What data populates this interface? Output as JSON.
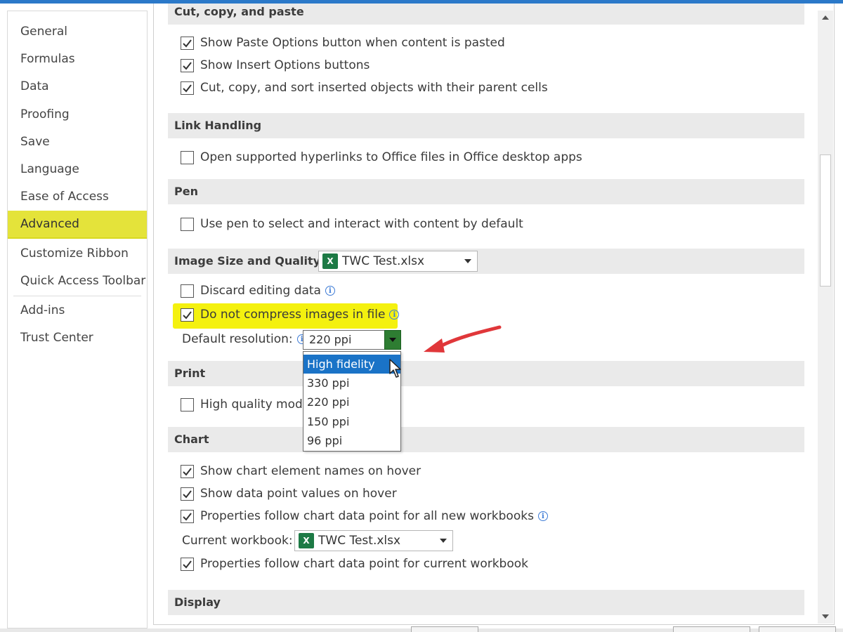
{
  "sidebar": {
    "items": [
      {
        "label": "General"
      },
      {
        "label": "Formulas"
      },
      {
        "label": "Data"
      },
      {
        "label": "Proofing"
      },
      {
        "label": "Save"
      },
      {
        "label": "Language"
      },
      {
        "label": "Ease of Access"
      },
      {
        "label": "Advanced",
        "active": true
      },
      {
        "label": "Customize Ribbon"
      },
      {
        "label": "Quick Access Toolbar"
      },
      {
        "label": "Add-ins"
      },
      {
        "label": "Trust Center"
      }
    ]
  },
  "sections": {
    "cut_copy_paste": {
      "title": "Cut, copy, and paste",
      "options": [
        {
          "label": "Show Paste Options button when content is pasted",
          "checked": true
        },
        {
          "label": "Show Insert Options buttons",
          "checked": true
        },
        {
          "label": "Cut, copy, and sort inserted objects with their parent cells",
          "checked": true
        }
      ]
    },
    "link_handling": {
      "title": "Link Handling",
      "options": [
        {
          "label": "Open supported hyperlinks to Office files in Office desktop apps",
          "checked": false
        }
      ]
    },
    "pen": {
      "title": "Pen",
      "options": [
        {
          "label": "Use pen to select and interact with content by default",
          "checked": false
        }
      ]
    },
    "image": {
      "title": "Image Size and Quality",
      "file_select": "TWC Test.xlsx",
      "discard_label": "Discard editing data",
      "discard_checked": false,
      "compress_label": "Do not compress images in file",
      "compress_checked": true,
      "resolution_label": "Default resolution:",
      "resolution_value": "220 ppi",
      "resolution_options": [
        "High fidelity",
        "330 ppi",
        "220 ppi",
        "150 ppi",
        "96 ppi"
      ],
      "resolution_highlighted": "High fidelity"
    },
    "print": {
      "title": "Print",
      "hq_label": "High quality mode",
      "hq_checked": false
    },
    "chart": {
      "title": "Chart",
      "options": [
        {
          "label": "Show chart element names on hover",
          "checked": true
        },
        {
          "label": "Show data point values on hover",
          "checked": true
        },
        {
          "label": "Properties follow chart data point for all new workbooks",
          "checked": true
        }
      ],
      "workbook_label": "Current workbook:",
      "workbook_select": "TWC Test.xlsx",
      "current_label": "Properties follow chart data point for current workbook",
      "current_checked": true
    },
    "display": {
      "title": "Display"
    }
  },
  "icons": {
    "excel_glyph": "X",
    "info_glyph": "i"
  },
  "colors": {
    "highlight": "#f4f10f",
    "selection": "#1a73c7",
    "arrow": "#e0373a",
    "title_bar": "#2b79c9"
  }
}
